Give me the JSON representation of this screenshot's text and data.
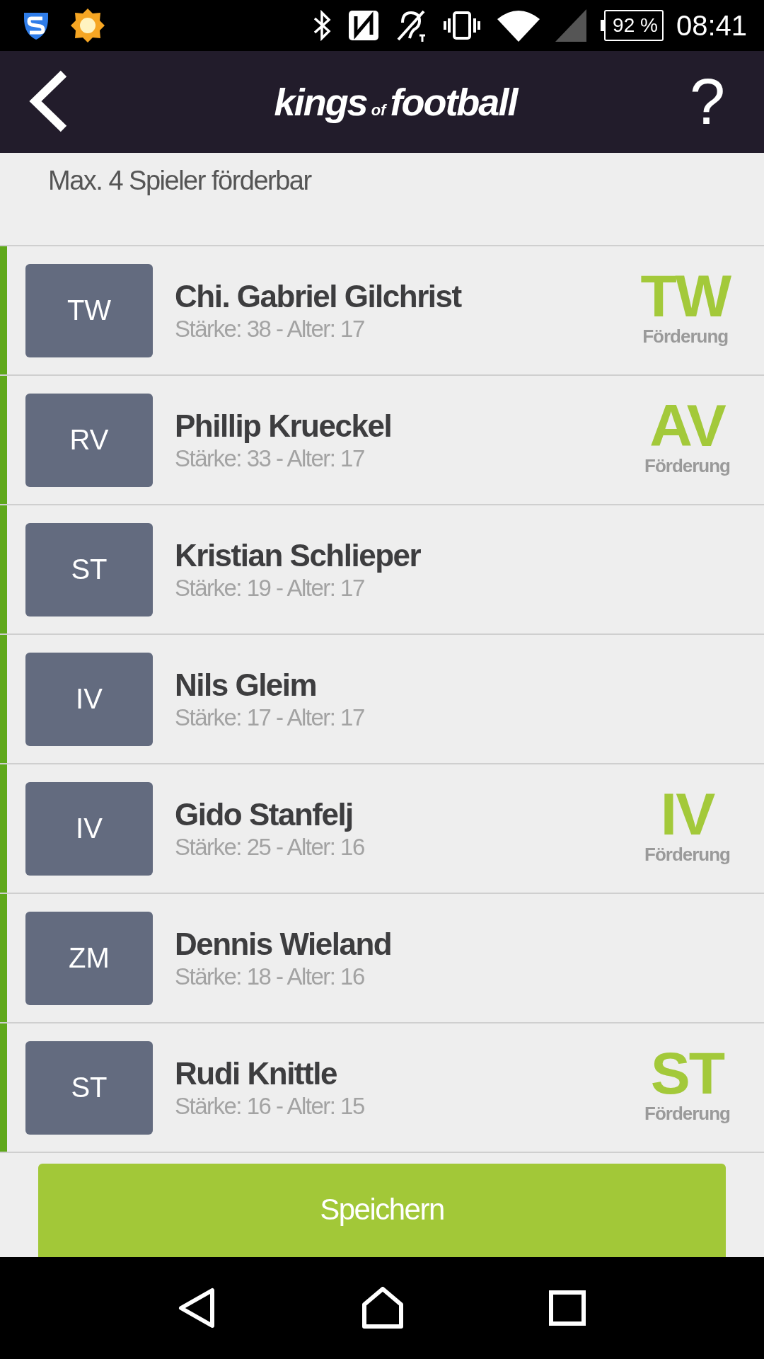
{
  "status_bar": {
    "battery": "92 %",
    "time": "08:41"
  },
  "header": {
    "logo": {
      "main": "kings",
      "small": "of",
      "tail": "football"
    },
    "help": "?"
  },
  "info": "Max. 4 Spieler förderbar",
  "players": [
    {
      "position": "TW",
      "name": "Chi. Gabriel Gilchrist",
      "details": "Stärke: 38 - Alter: 17",
      "promotion": {
        "position": "TW",
        "label": "Förderung"
      }
    },
    {
      "position": "RV",
      "name": "Phillip Krueckel",
      "details": "Stärke: 33 - Alter: 17",
      "promotion": {
        "position": "AV",
        "label": "Förderung"
      }
    },
    {
      "position": "ST",
      "name": "Kristian Schlieper",
      "details": "Stärke: 19 - Alter: 17"
    },
    {
      "position": "IV",
      "name": "Nils Gleim",
      "details": "Stärke: 17 - Alter: 17"
    },
    {
      "position": "IV",
      "name": "Gido Stanfelj",
      "details": "Stärke: 25 - Alter: 16",
      "promotion": {
        "position": "IV",
        "label": "Förderung"
      }
    },
    {
      "position": "ZM",
      "name": "Dennis Wieland",
      "details": "Stärke: 18 - Alter: 16"
    },
    {
      "position": "ST",
      "name": "Rudi Knittle",
      "details": "Stärke: 16 - Alter: 15",
      "promotion": {
        "position": "ST",
        "label": "Förderung"
      }
    }
  ],
  "save_button": "Speichern"
}
